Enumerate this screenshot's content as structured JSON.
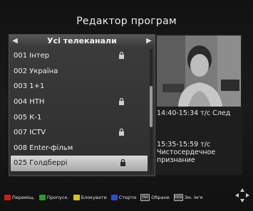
{
  "screen": {
    "title": "Редактор програм"
  },
  "group": {
    "prev_arrow": "◀",
    "label": "Усі телеканали",
    "next_arrow": "▶"
  },
  "channels": [
    {
      "name": "001 Інтер",
      "locked": true
    },
    {
      "name": "002 Україна",
      "locked": false
    },
    {
      "name": "003 1+1",
      "locked": false
    },
    {
      "name": "004 НТН",
      "locked": true
    },
    {
      "name": "005 К-1",
      "locked": false
    },
    {
      "name": "007 ICTV",
      "locked": true
    },
    {
      "name": "008 Enter-фільм",
      "locked": false
    },
    {
      "name": "025 Голдберрі",
      "locked": true,
      "selected": true
    }
  ],
  "epg": {
    "now": "14:40-15:34  т/с След",
    "next_time": "15:35-15:59  т/с",
    "next_title_1": "Чистосердечное",
    "next_title_2": "признание"
  },
  "legend": {
    "move": "Перемiщ.",
    "skip": "Пропуск.",
    "lock": "Блокувати",
    "delete": "Стерти",
    "fav": "Обране",
    "rename": "Зм. ім'я",
    "fav_icon_text": "FAV",
    "rename_icon_text": "REN"
  },
  "colors": {
    "red": "#c81e1e",
    "green": "#2a9a2a",
    "yellow": "#d6c21a",
    "blue": "#2a4fc8"
  },
  "icons": {
    "lock": "lock-icon",
    "nav": "navigation-arrows-icon"
  }
}
